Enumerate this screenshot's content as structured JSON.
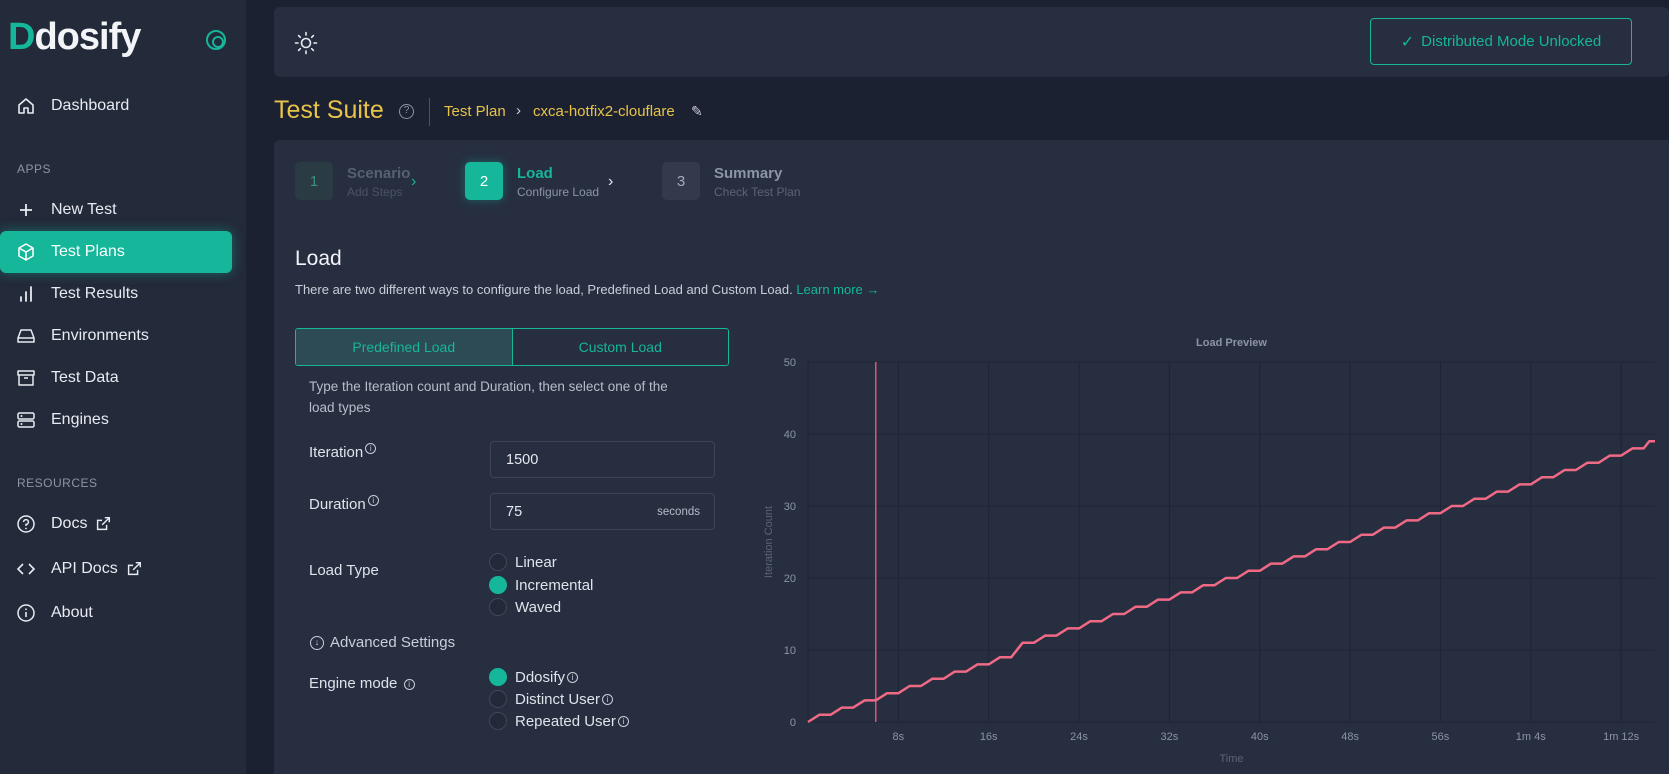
{
  "sidebar": {
    "logo": "Ddosify",
    "dashboard": "Dashboard",
    "apps_label": "APPS",
    "items": [
      {
        "label": "New Test"
      },
      {
        "label": "Test Plans"
      },
      {
        "label": "Test Results"
      },
      {
        "label": "Environments"
      },
      {
        "label": "Test Data"
      },
      {
        "label": "Engines"
      }
    ],
    "resources_label": "RESOURCES",
    "resources": [
      {
        "label": "Docs"
      },
      {
        "label": "API Docs"
      },
      {
        "label": "About"
      }
    ]
  },
  "topbar": {
    "distributed_label": "Distributed Mode Unlocked"
  },
  "header": {
    "title": "Test Suite",
    "breadcrumb_plan": "Test Plan",
    "breadcrumb_name": "cxca-hotfix2-clouflare"
  },
  "steps": [
    {
      "num": "1",
      "title": "Scenario",
      "sub": "Add Steps"
    },
    {
      "num": "2",
      "title": "Load",
      "sub": "Configure Load"
    },
    {
      "num": "3",
      "title": "Summary",
      "sub": "Check Test Plan"
    }
  ],
  "load": {
    "heading": "Load",
    "description": "There are two different ways to configure the load, Predefined Load and Custom Load.",
    "learn_more": "Learn more →",
    "tab_predefined": "Predefined Load",
    "tab_custom": "Custom Load",
    "hint": "Type the Iteration count and Duration, then select one of the load types",
    "iteration_label": "Iteration",
    "iteration_value": "1500",
    "duration_label": "Duration",
    "duration_value": "75",
    "duration_unit": "seconds",
    "load_type_label": "Load Type",
    "load_types": [
      "Linear",
      "Incremental",
      "Waved"
    ],
    "load_type_selected": "Incremental",
    "advanced": "Advanced Settings",
    "engine_mode_label": "Engine mode",
    "engine_modes": [
      "Ddosify",
      "Distinct User",
      "Repeated User"
    ],
    "engine_mode_selected": "Ddosify"
  },
  "colors": {
    "accent": "#15b69a",
    "title": "#e8c34a",
    "line": "#f06a85"
  },
  "chart_data": {
    "type": "line",
    "title": "Load Preview",
    "xlabel": "Time",
    "ylabel": "Iteration Count",
    "ylim": [
      0,
      50
    ],
    "xlim": [
      0,
      75
    ],
    "y_ticks": [
      "0",
      "10",
      "20",
      "30",
      "40",
      "50"
    ],
    "x_ticks": [
      {
        "label": "8s",
        "t": 8
      },
      {
        "label": "16s",
        "t": 16
      },
      {
        "label": "24s",
        "t": 24
      },
      {
        "label": "32s",
        "t": 32
      },
      {
        "label": "40s",
        "t": 40
      },
      {
        "label": "48s",
        "t": 48
      },
      {
        "label": "56s",
        "t": 56
      },
      {
        "label": "1m 4s",
        "t": 64
      },
      {
        "label": "1m 12s",
        "t": 72
      }
    ],
    "marker_t": 6,
    "grid": true,
    "series": [
      {
        "x": [
          0,
          2,
          4,
          6,
          8,
          10,
          12,
          14,
          16,
          18,
          20,
          22,
          24,
          26,
          28,
          30,
          32,
          34,
          36,
          38,
          40,
          42,
          44,
          46,
          48,
          50,
          52,
          54,
          56,
          58,
          60,
          62,
          64,
          66,
          68,
          70,
          72,
          74,
          75
        ],
        "values": [
          0,
          1,
          2,
          3,
          4,
          5,
          6,
          7,
          8,
          9,
          11,
          12,
          13,
          14,
          15,
          16,
          17,
          18,
          19,
          20,
          21,
          22,
          23,
          24,
          25,
          26,
          27,
          28,
          29,
          30,
          31,
          32,
          33,
          34,
          35,
          36,
          37,
          38,
          39
        ]
      }
    ]
  }
}
